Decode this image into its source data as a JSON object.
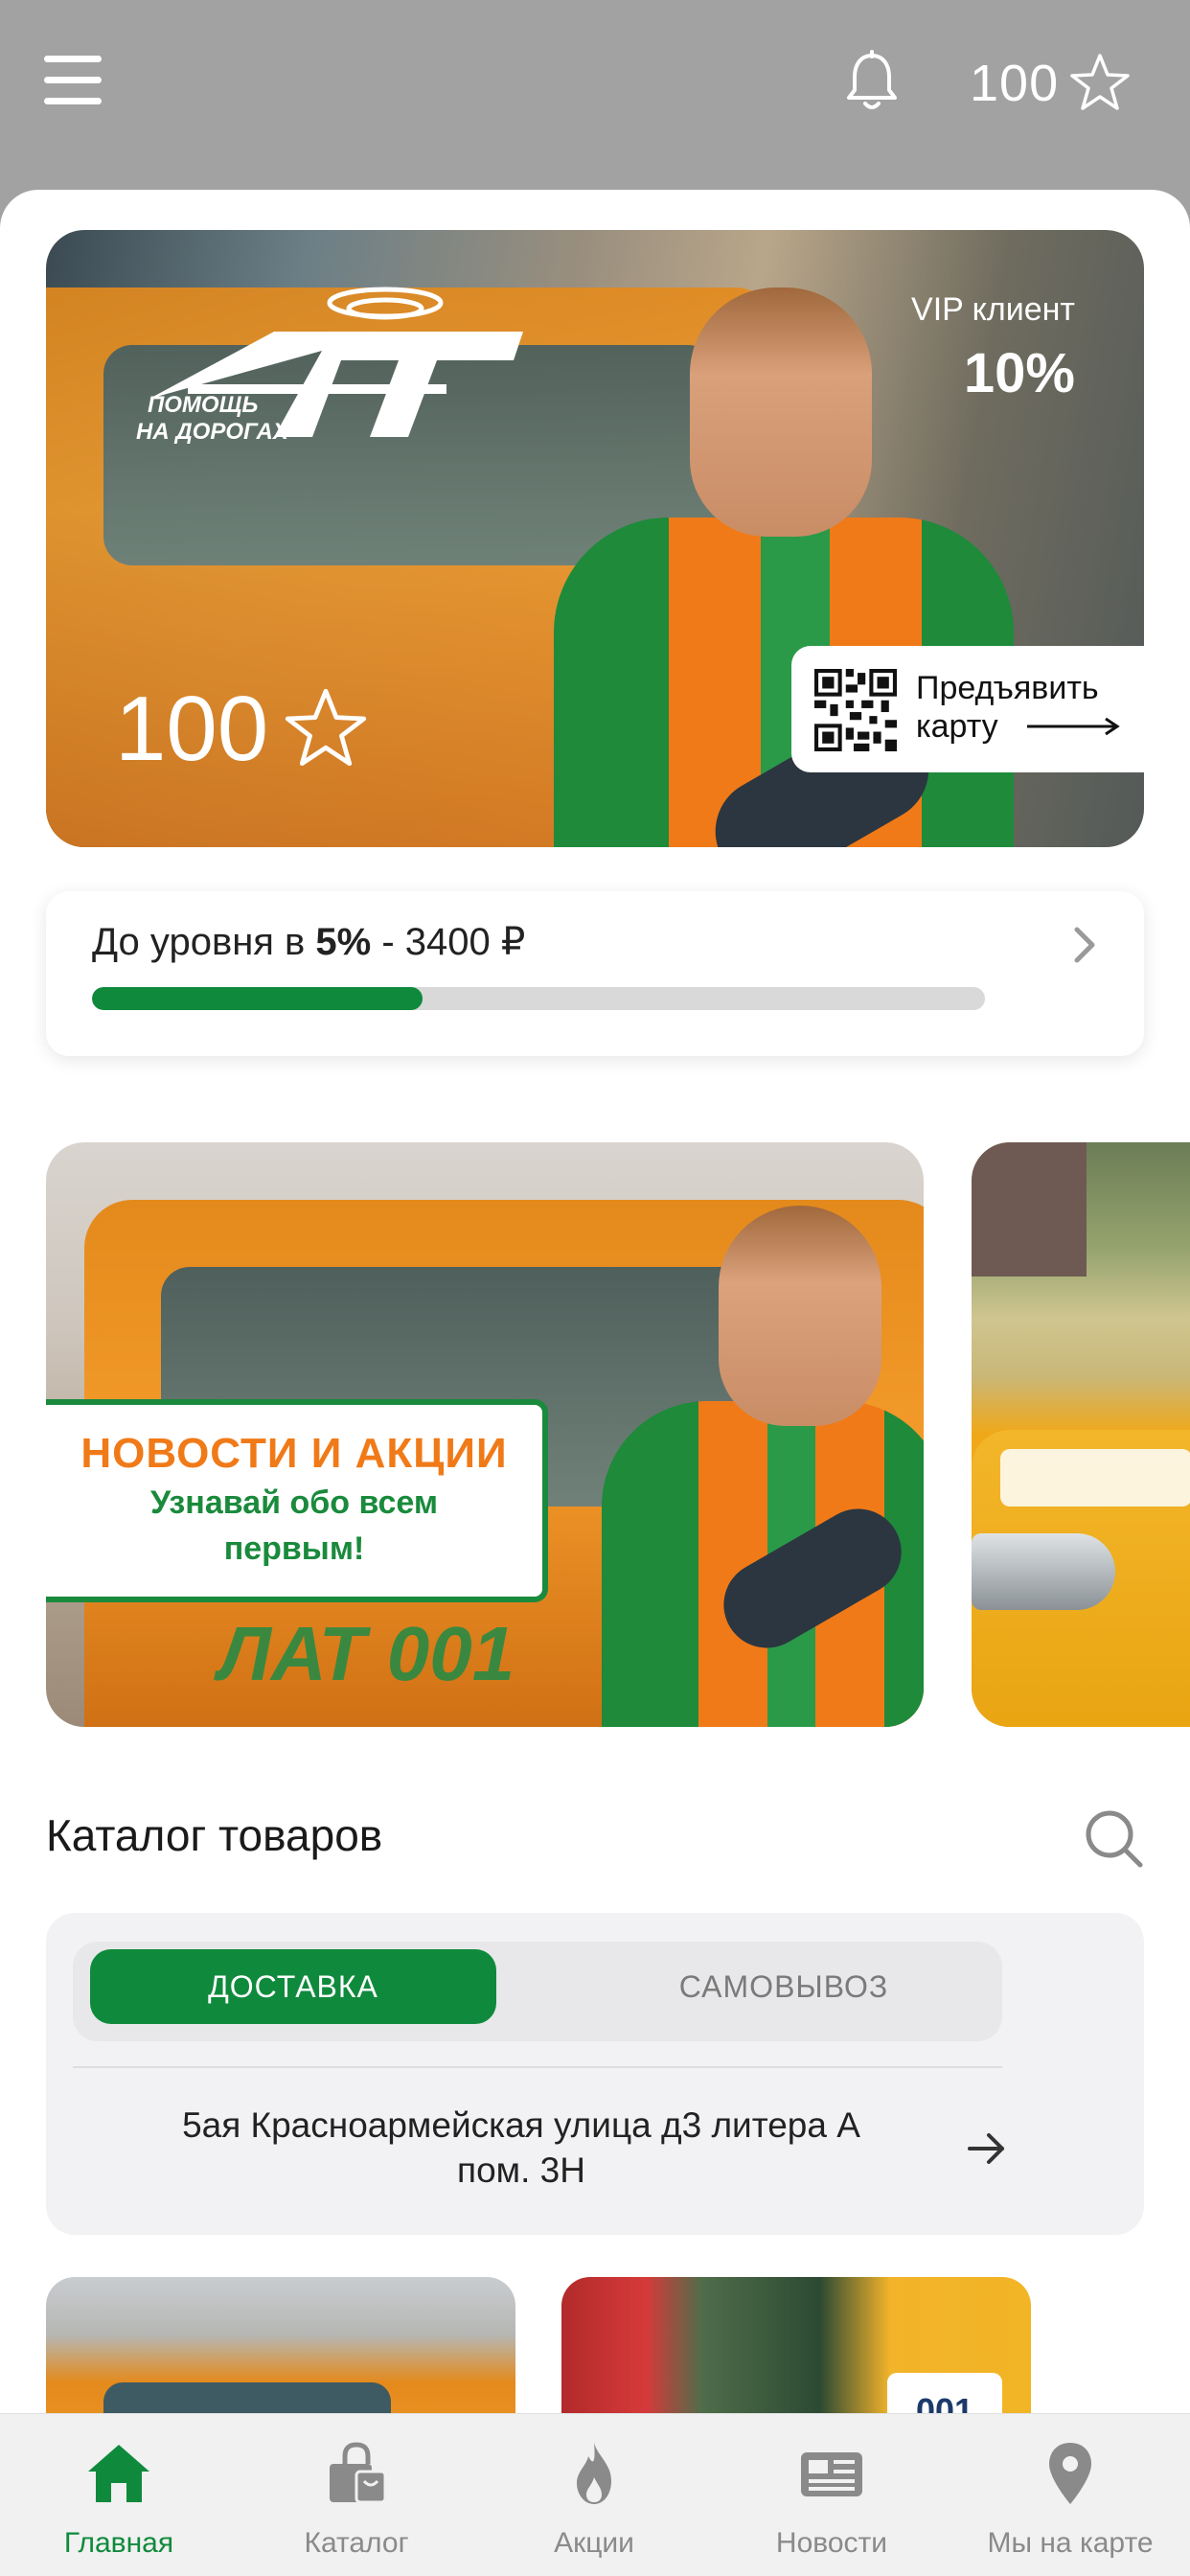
{
  "topbar": {
    "points": "100"
  },
  "loyalty_card": {
    "logo_text": "ЛАТ",
    "logo_tagline_1": "ПОМОЩЬ",
    "logo_tagline_2": "НА ДОРОГАХ",
    "status_label": "VIP клиент",
    "discount": "10%",
    "points": "100",
    "present_label_1": "Предъявить",
    "present_label_2": "карту"
  },
  "progress": {
    "prefix": "До уровня в ",
    "level": "5%",
    "suffix": " - 3400 ₽",
    "fraction": 0.37
  },
  "banners": [
    {
      "title": "НОВОСТИ И АКЦИИ",
      "subtitle_1": "Узнавай обо всем",
      "subtitle_2": "первым!",
      "brand": "ЛАТ 001"
    }
  ],
  "catalog": {
    "title": "Каталог товаров",
    "tabs": [
      "ДОСТАВКА",
      "САМОВЫВОЗ"
    ],
    "active_tab": 0,
    "address_line_1": "5ая Красноармейская улица д3 литера А",
    "address_line_2": "пом. 3Н",
    "thumb2_plate": "001"
  },
  "tabbar": {
    "items": [
      {
        "label": "Главная",
        "icon": "home-icon"
      },
      {
        "label": "Каталог",
        "icon": "shopping-bag-icon"
      },
      {
        "label": "Акции",
        "icon": "flame-icon"
      },
      {
        "label": "Новости",
        "icon": "news-icon"
      },
      {
        "label": "Мы на карте",
        "icon": "map-pin-icon"
      }
    ],
    "active": 0
  },
  "colors": {
    "accent": "#0f8a3c",
    "header_bg": "#a2a2a2",
    "banner_orange": "#f07a18"
  }
}
